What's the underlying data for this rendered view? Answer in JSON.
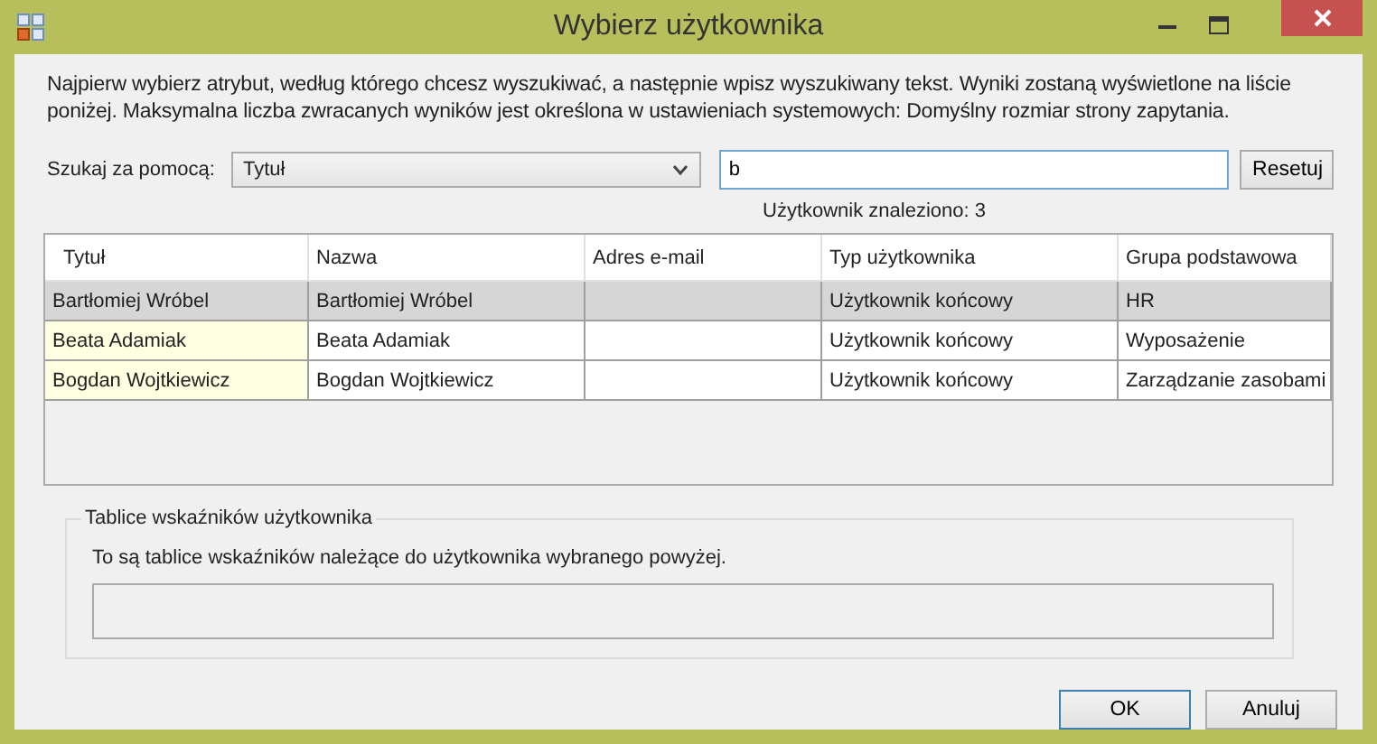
{
  "window": {
    "title": "Wybierz użytkownika"
  },
  "description": "Najpierw wybierz atrybut, według którego chcesz wyszukiwać, a następnie wpisz wyszukiwany tekst. Wyniki zostaną wyświetlone na liście poniżej. Maksymalna liczba zwracanych wyników jest określona w ustawieniach systemowych: Domyślny rozmiar strony zapytania.",
  "search": {
    "label": "Szukaj za pomocą:",
    "attribute": "Tytuł",
    "value": "b",
    "reset": "Resetuj",
    "count": "Użytkownik znaleziono: 3"
  },
  "table": {
    "columns": [
      "Tytuł",
      "Nazwa",
      "Adres e-mail",
      "Typ użytkownika",
      "Grupa podstawowa"
    ],
    "rows": [
      {
        "selected": true,
        "cells": [
          "Bartłomiej Wróbel",
          "Bartłomiej Wróbel",
          "",
          "Użytkownik końcowy",
          "HR"
        ]
      },
      {
        "selected": false,
        "cells": [
          "Beata Adamiak",
          "Beata Adamiak",
          "",
          "Użytkownik końcowy",
          "Wyposażenie"
        ]
      },
      {
        "selected": false,
        "cells": [
          "Bogdan Wojtkiewicz",
          "Bogdan Wojtkiewicz",
          "",
          "Użytkownik końcowy",
          "Zarządzanie zasobami"
        ]
      }
    ]
  },
  "dashboards": {
    "title": "Tablice wskaźników użytkownika",
    "text": "To są tablice wskaźników należące do użytkownika wybranego powyżej."
  },
  "buttons": [
    {
      "label": "OK",
      "default": true
    },
    {
      "label": "Anuluj",
      "default": false
    }
  ]
}
